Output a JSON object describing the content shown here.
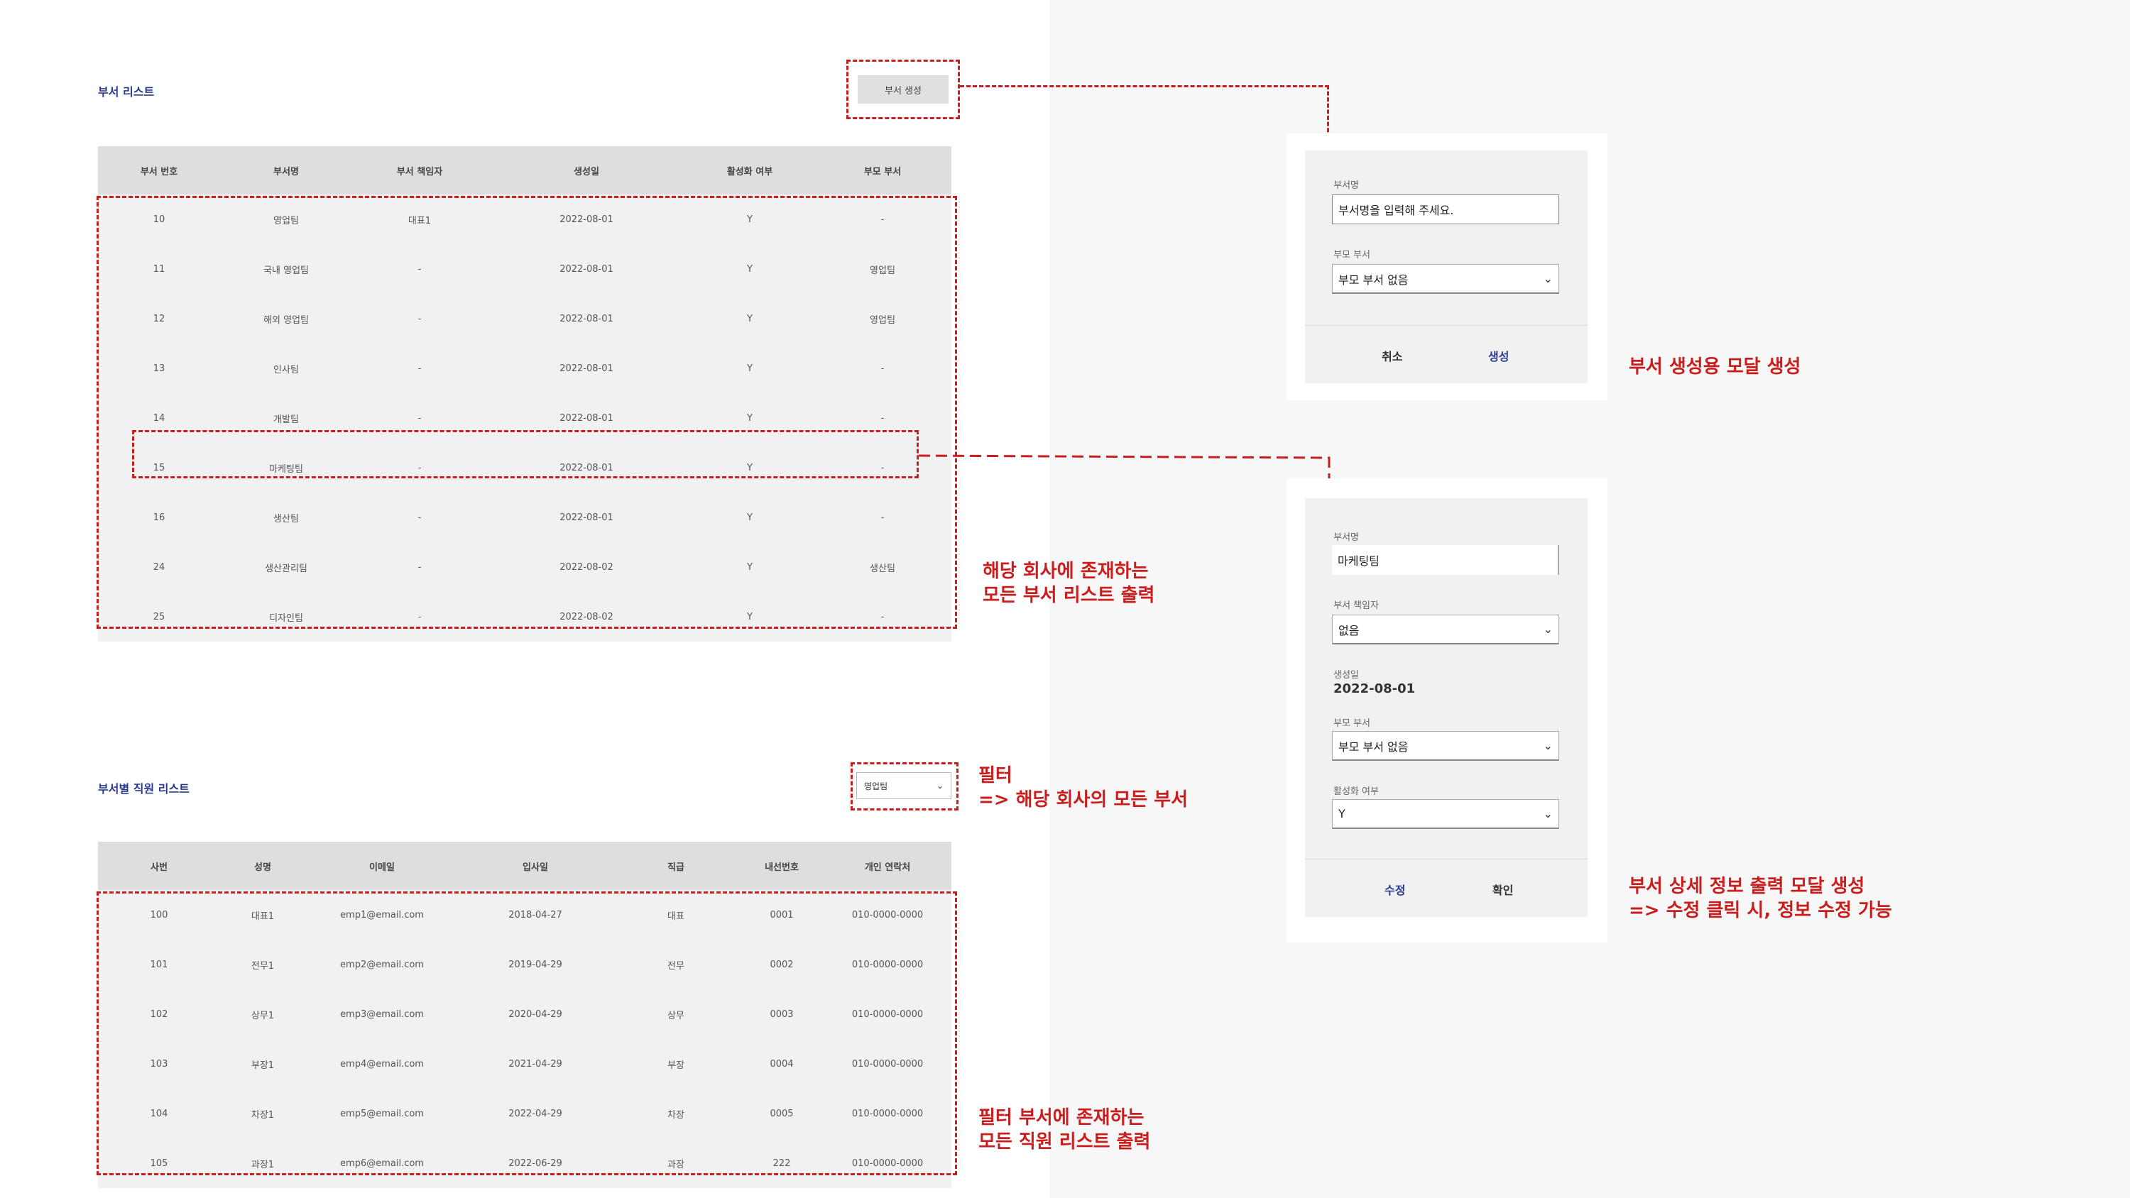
{
  "dept_section": {
    "title": "부서 리스트",
    "create_button": "부서 생성",
    "columns": [
      "부서 번호",
      "부서명",
      "부서 책임자",
      "생성일",
      "활성화 여부",
      "부모 부서"
    ],
    "rows": [
      [
        "10",
        "영업팀",
        "대표1",
        "2022-08-01",
        "Y",
        "-"
      ],
      [
        "11",
        "국내 영업팀",
        "-",
        "2022-08-01",
        "Y",
        "영업팀"
      ],
      [
        "12",
        "해외 영업팀",
        "-",
        "2022-08-01",
        "Y",
        "영업팀"
      ],
      [
        "13",
        "인사팀",
        "-",
        "2022-08-01",
        "Y",
        "-"
      ],
      [
        "14",
        "개발팀",
        "-",
        "2022-08-01",
        "Y",
        "-"
      ],
      [
        "15",
        "마케팅팀",
        "-",
        "2022-08-01",
        "Y",
        "-"
      ],
      [
        "16",
        "생산팀",
        "-",
        "2022-08-01",
        "Y",
        "-"
      ],
      [
        "24",
        "생산관리팀",
        "-",
        "2022-08-02",
        "Y",
        "생산팀"
      ],
      [
        "25",
        "디자인팀",
        "-",
        "2022-08-02",
        "Y",
        "-"
      ]
    ]
  },
  "emp_section": {
    "title": "부서별 직원 리스트",
    "filter_value": "영업팀",
    "columns": [
      "사번",
      "성명",
      "이메일",
      "입사일",
      "직급",
      "내선번호",
      "개인 연락처"
    ],
    "rows": [
      [
        "100",
        "대표1",
        "emp1@email.com",
        "2018-04-27",
        "대표",
        "0001",
        "010-0000-0000"
      ],
      [
        "101",
        "전무1",
        "emp2@email.com",
        "2019-04-29",
        "전무",
        "0002",
        "010-0000-0000"
      ],
      [
        "102",
        "상무1",
        "emp3@email.com",
        "2020-04-29",
        "상무",
        "0003",
        "010-0000-0000"
      ],
      [
        "103",
        "부장1",
        "emp4@email.com",
        "2021-04-29",
        "부장",
        "0004",
        "010-0000-0000"
      ],
      [
        "104",
        "차장1",
        "emp5@email.com",
        "2022-04-29",
        "차장",
        "0005",
        "010-0000-0000"
      ],
      [
        "105",
        "과장1",
        "emp6@email.com",
        "2022-06-29",
        "과장",
        "222",
        "010-0000-0000"
      ]
    ]
  },
  "create_modal": {
    "name_label": "부서명",
    "name_placeholder": "부서명을 입력해 주세요.",
    "parent_label": "부모 부서",
    "parent_value": "부모 부서 없음",
    "cancel_button": "취소",
    "create_button": "생성"
  },
  "detail_modal": {
    "name_label": "부서명",
    "name_value": "마케팅팀",
    "manager_label": "부서 책임자",
    "manager_value": "없음",
    "created_label": "생성일",
    "created_value": "2022-08-01",
    "parent_label": "부모 부서",
    "parent_value": "부모 부서 없음",
    "active_label": "활성화 여부",
    "active_value": "Y",
    "edit_button": "수정",
    "confirm_button": "확인"
  },
  "annotations": {
    "create_modal_line1": "부서 생성용 모달 생성",
    "dept_list_line1": "해당 회사에 존재하는",
    "dept_list_line2": "모든 부서 리스트 출력",
    "filter_line1": "필터",
    "filter_line2": "=> 해당 회사의 모든 부서",
    "emp_list_line1": "필터 부서에 존재하는",
    "emp_list_line2": "모든 직원 리스트 출력",
    "detail_modal_line1": "부서 상세 정보 출력 모달 생성",
    "detail_modal_line2": "=> 수정 클릭 시, 정보 수정 가능"
  },
  "colors": {
    "accent_title": "#2b3a8f",
    "annotation_red": "#c81e1e"
  }
}
